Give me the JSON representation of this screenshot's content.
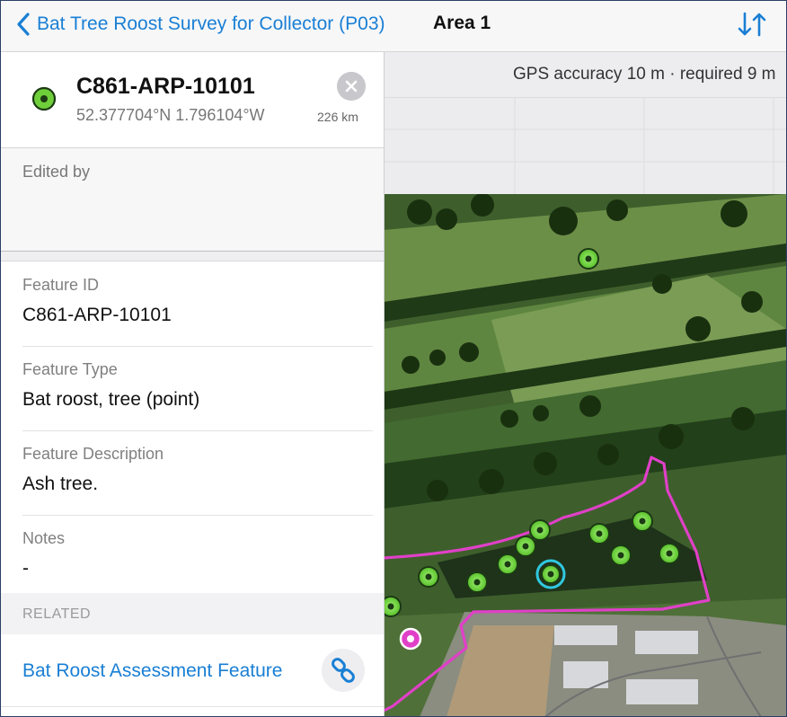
{
  "nav": {
    "back_label": "Bat Tree Roost Survey for Collector (P03)",
    "title": "Area 1",
    "sort_icon": "sort-arrows-icon"
  },
  "map": {
    "gps_status": "GPS accuracy 10 m · required 9 m"
  },
  "feature": {
    "title": "C861-ARP-10101",
    "coordinates": "52.377704°N  1.796104°W",
    "distance": "226 km",
    "edited_by_label": "Edited by"
  },
  "fields": [
    {
      "label": "Feature ID",
      "value": "C861-ARP-10101"
    },
    {
      "label": "Feature Type",
      "value": "Bat roost, tree (point)"
    },
    {
      "label": "Feature Description",
      "value": "Ash tree."
    },
    {
      "label": "Notes",
      "value": "-"
    }
  ],
  "related": {
    "header": "RELATED",
    "link_label": "Bat Roost Assessment Feature",
    "link_icon": "link-icon"
  },
  "colors": {
    "accent_blue": "#1a7fd4",
    "boundary_magenta": "#e040c8",
    "point_green": "#6fcf3a",
    "selected_cyan": "#30c8e0"
  }
}
